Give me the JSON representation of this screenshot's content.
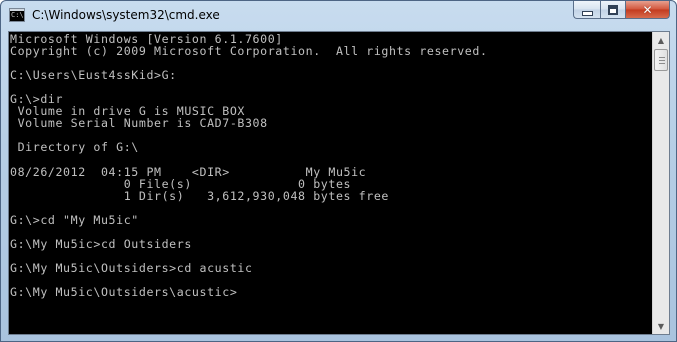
{
  "window": {
    "title": "C:\\Windows\\system32\\cmd.exe",
    "icon_name": "cmd-icon",
    "icon_text": "C:\\"
  },
  "console": {
    "lines": [
      "Microsoft Windows [Version 6.1.7600]",
      "Copyright (c) 2009 Microsoft Corporation.  All rights reserved.",
      "",
      "C:\\Users\\Eust4ssKid>G:",
      "",
      "G:\\>dir",
      " Volume in drive G is MUSIC BOX",
      " Volume Serial Number is CAD7-B308",
      "",
      " Directory of G:\\",
      "",
      "08/26/2012  04:15 PM    <DIR>          My Mu5ic",
      "               0 File(s)              0 bytes",
      "               1 Dir(s)   3,612,930,048 bytes free",
      "",
      "G:\\>cd \"My Mu5ic\"",
      "",
      "G:\\My Mu5ic>cd Outsiders",
      "",
      "G:\\My Mu5ic\\Outsiders>cd acustic",
      "",
      "G:\\My Mu5ic\\Outsiders\\acustic>"
    ]
  },
  "colors": {
    "console_background": "#000000",
    "console_text": "#c0c0c0"
  }
}
